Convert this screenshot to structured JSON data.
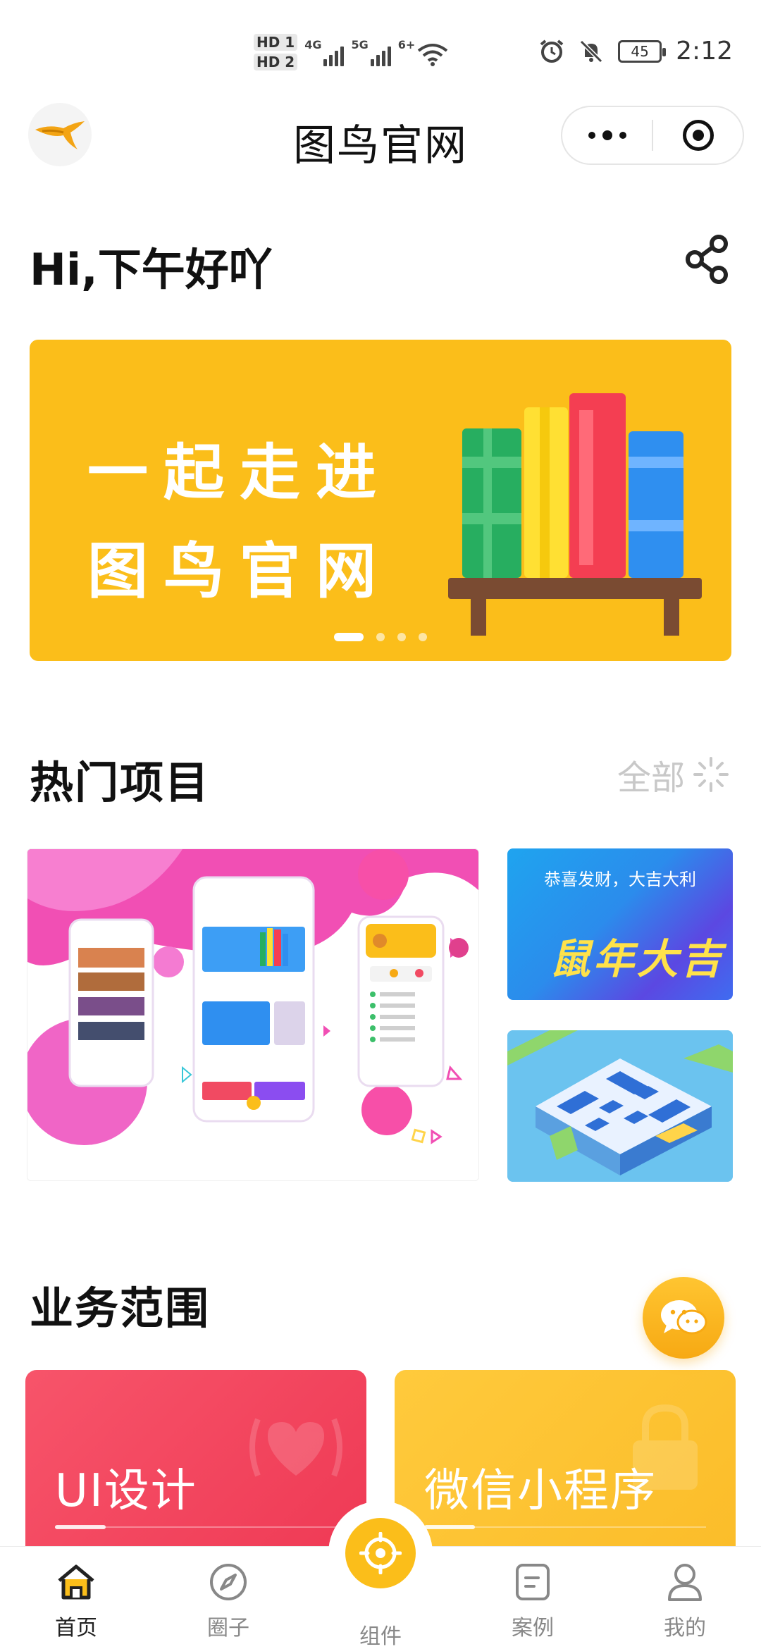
{
  "status_bar": {
    "hd1": "HD 1",
    "hd2": "HD 2",
    "net1": "4G",
    "net2": "5G",
    "wifi_label": "6+",
    "battery": "45",
    "time": "2:12"
  },
  "title_bar": {
    "title": "图鸟官网"
  },
  "greeting": "Hi,下午好吖",
  "banner": {
    "line1": "一起走进",
    "line2": "图鸟官网"
  },
  "hot_projects": {
    "title": "热门项目",
    "see_all": "全部",
    "card_small_1_caption": "恭喜发财，大吉大利",
    "card_small_1_art": "鼠年大吉"
  },
  "services": {
    "title": "业务范围",
    "items": [
      {
        "label": "UI设计"
      },
      {
        "label": "微信小程序"
      }
    ]
  },
  "tab_bar": {
    "items": [
      {
        "label": "首页"
      },
      {
        "label": "圈子"
      },
      {
        "label": "组件"
      },
      {
        "label": "案例"
      },
      {
        "label": "我的"
      }
    ]
  },
  "colors": {
    "brand_yellow": "#fbbe1a",
    "service_red": "#f14a62",
    "chat_orange": "#f7a913"
  }
}
